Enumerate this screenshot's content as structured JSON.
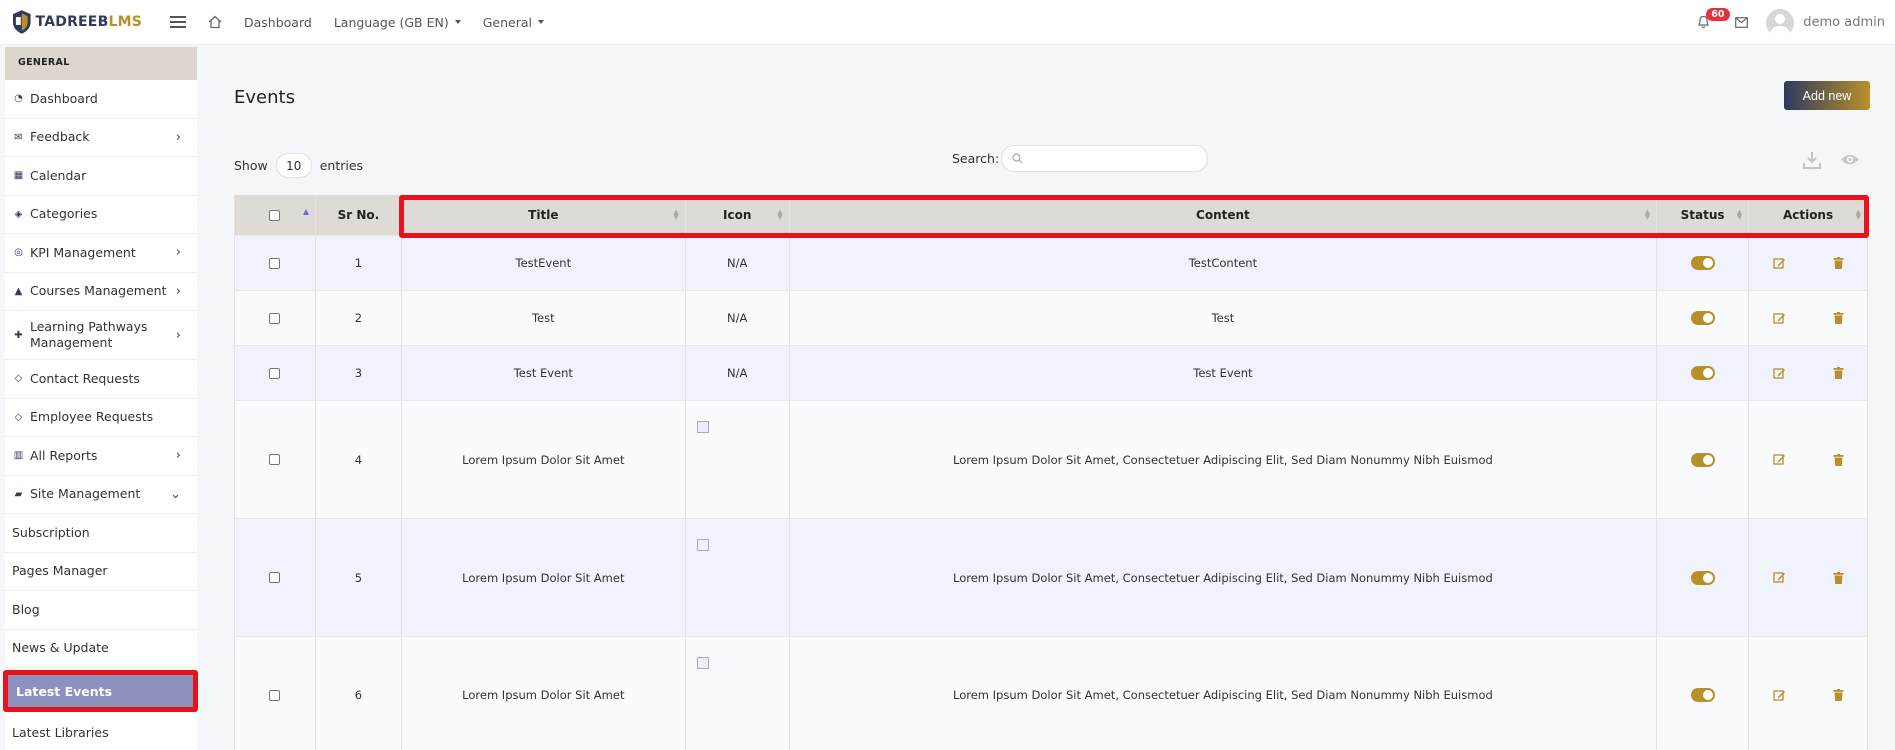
{
  "brand": {
    "logo_part1": "TADREEB",
    "logo_part2": "LMS"
  },
  "topbar": {
    "nav": [
      {
        "label": "Dashboard",
        "dropdown": false
      },
      {
        "label": "Language (GB EN)",
        "dropdown": true
      },
      {
        "label": "General",
        "dropdown": true
      }
    ],
    "notification_count": "60",
    "user_name": "demo admin"
  },
  "sidebar": {
    "section_label": "GENERAL",
    "items": [
      {
        "label": "Dashboard",
        "icon": "dashboard-icon",
        "chevron": ""
      },
      {
        "label": "Feedback",
        "icon": "comments-icon",
        "chevron": "›"
      },
      {
        "label": "Calendar",
        "icon": "calendar-icon",
        "chevron": ""
      },
      {
        "label": "Categories",
        "icon": "tags-icon",
        "chevron": ""
      },
      {
        "label": "KPI Management",
        "icon": "target-icon",
        "chevron": "›"
      },
      {
        "label": "Courses Management",
        "icon": "graduation-cap-icon",
        "chevron": "›"
      },
      {
        "label": "Learning Pathways Management",
        "icon": "puzzle-icon",
        "chevron": "›"
      },
      {
        "label": "Contact Requests",
        "icon": "tag-icon",
        "chevron": ""
      },
      {
        "label": "Employee Requests",
        "icon": "tag-icon",
        "chevron": ""
      },
      {
        "label": "All Reports",
        "icon": "chart-icon",
        "chevron": "›"
      },
      {
        "label": "Site Management",
        "icon": "folder-icon",
        "chevron": "⌄"
      },
      {
        "label": "Subscription",
        "icon": "",
        "chevron": ""
      },
      {
        "label": "Pages Manager",
        "icon": "",
        "chevron": ""
      },
      {
        "label": "Blog",
        "icon": "",
        "chevron": ""
      },
      {
        "label": "News & Update",
        "icon": "",
        "chevron": ""
      }
    ],
    "active_item": "Latest Events",
    "after_items": [
      {
        "label": "Latest Libraries"
      }
    ]
  },
  "page": {
    "title": "Events",
    "add_button": "Add new",
    "show_label": "Show",
    "page_size": "10",
    "entries_label": "entries",
    "search_label": "Search:",
    "search_placeholder": ""
  },
  "table": {
    "columns": [
      "Sr No.",
      "Title",
      "Icon",
      "Content",
      "Status",
      "Actions"
    ],
    "rows": [
      {
        "sr": "1",
        "title": "TestEvent",
        "icon": "N/A",
        "content": "TestContent",
        "status_on": true
      },
      {
        "sr": "2",
        "title": "Test",
        "icon": "N/A",
        "content": "Test",
        "status_on": true
      },
      {
        "sr": "3",
        "title": "Test Event",
        "icon": "N/A",
        "content": "Test Event",
        "status_on": true
      },
      {
        "sr": "4",
        "title": "Lorem Ipsum Dolor Sit Amet",
        "icon": "",
        "content": "Lorem Ipsum Dolor Sit Amet, Consectetuer Adipiscing Elit, Sed Diam Nonummy Nibh Euismod",
        "status_on": true
      },
      {
        "sr": "5",
        "title": "Lorem Ipsum Dolor Sit Amet",
        "icon": "",
        "content": "Lorem Ipsum Dolor Sit Amet, Consectetuer Adipiscing Elit, Sed Diam Nonummy Nibh Euismod",
        "status_on": true
      },
      {
        "sr": "6",
        "title": "Lorem Ipsum Dolor Sit Amet",
        "icon": "",
        "content": "Lorem Ipsum Dolor Sit Amet, Consectetuer Adipiscing Elit, Sed Diam Nonummy Nibh Euismod",
        "status_on": true
      }
    ]
  },
  "colors": {
    "brand_navy": "#2e3a5e",
    "brand_gold": "#b8902a",
    "highlight_red": "#e8131a",
    "active_item_bg": "#8c91bd"
  }
}
